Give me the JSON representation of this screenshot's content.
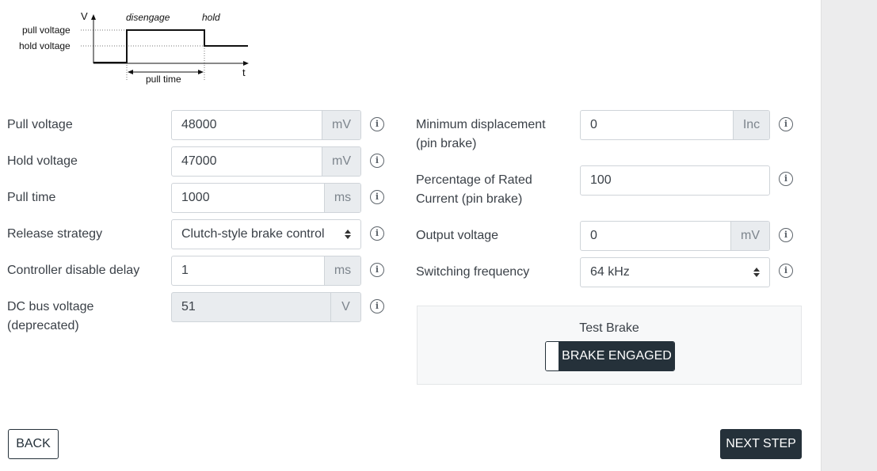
{
  "diagram": {
    "axis_v": "V",
    "axis_t": "t",
    "phase_disengage": "disengage",
    "phase_hold": "hold",
    "pull_voltage": "pull voltage",
    "hold_voltage": "hold voltage",
    "pull_time": "pull time"
  },
  "left_fields": [
    {
      "label": "Pull voltage",
      "value": "48000",
      "unit": "mV"
    },
    {
      "label": "Hold voltage",
      "value": "47000",
      "unit": "mV"
    },
    {
      "label": "Pull time",
      "value": "1000",
      "unit": "ms"
    },
    {
      "label": "Release strategy",
      "value": "Clutch-style brake control"
    },
    {
      "label": "Controller disable delay",
      "value": "1",
      "unit": "ms"
    },
    {
      "label_line1": "DC bus voltage",
      "label_line2": "(deprecated)",
      "value": "51",
      "unit": "V"
    }
  ],
  "right_fields": [
    {
      "label_line1": "Minimum displacement",
      "label_line2": "(pin brake)",
      "value": "0",
      "unit": "Inc"
    },
    {
      "label_line1": "Percentage of Rated",
      "label_line2": "Current (pin brake)",
      "value": "100"
    },
    {
      "label": "Output voltage",
      "value": "0",
      "unit": "mV"
    },
    {
      "label": "Switching frequency",
      "value": "64 kHz"
    }
  ],
  "test_brake": {
    "title": "Test Brake",
    "state": "BRAKE ENGAGED"
  },
  "nav": {
    "back": "BACK",
    "next": "NEXT STEP"
  },
  "info_glyph": "i",
  "colors": {
    "dark": "#25313a",
    "text": "#3b4148",
    "addon_bg": "#e9ecef"
  }
}
